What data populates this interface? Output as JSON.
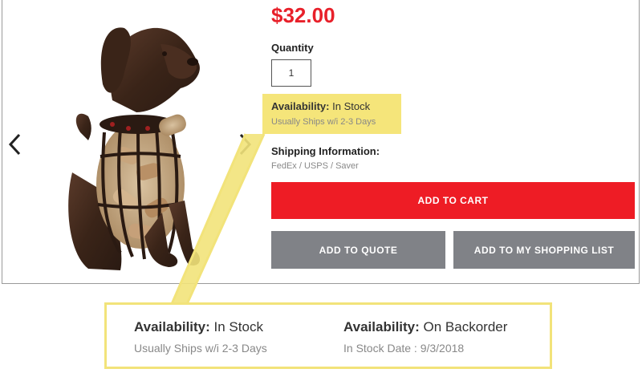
{
  "product": {
    "price": "$32.00",
    "quantity_label": "Quantity",
    "quantity_value": "1",
    "availability_label": "Availability:",
    "availability_value": "In Stock",
    "ships_text": "Usually Ships w/i 2-3 Days",
    "shipping_label": "Shipping Information:",
    "shipping_value": "FedEx / USPS / Saver"
  },
  "buttons": {
    "add_to_cart": "ADD TO CART",
    "add_to_quote": "ADD TO QUOTE",
    "add_to_list": "ADD TO MY SHOPPING LIST"
  },
  "gallery": {
    "prev_icon": "chevron-left-icon",
    "next_icon": "chevron-right-icon",
    "image": "dog-cork-holder"
  },
  "callout": {
    "in_stock": {
      "label": "Availability:",
      "value": "In Stock",
      "sub": "Usually Ships w/i 2-3 Days"
    },
    "backorder": {
      "label": "Availability:",
      "value": "On Backorder",
      "sub": "In Stock Date : 9/3/2018"
    }
  },
  "colors": {
    "price": "#e8202a",
    "cart_button": "#ee1c25",
    "secondary_button": "#808287",
    "highlight": "#f5e57a"
  }
}
